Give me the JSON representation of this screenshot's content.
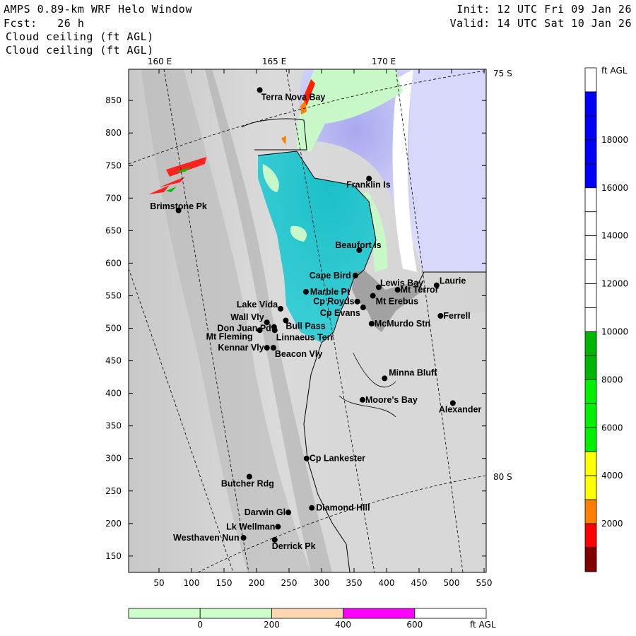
{
  "header": {
    "title": "AMPS 0.89-km WRF Helo Window",
    "forecast": "Fcst:   26 h",
    "init": "Init: 12 UTC Fri 09 Jan 26",
    "valid": "Valid: 14 UTC Sat 10 Jan 26",
    "field1": "Cloud ceiling (ft AGL)",
    "field2": "Cloud ceiling (ft AGL)"
  },
  "map": {
    "lon_labels": [
      "160 E",
      "165 E",
      "170 E"
    ],
    "lat_labels": [
      "75 S",
      "80 S"
    ],
    "x_ticks": [
      50,
      100,
      150,
      200,
      250,
      300,
      350,
      400,
      450,
      500,
      550
    ],
    "y_ticks": [
      150,
      200,
      250,
      300,
      350,
      400,
      450,
      500,
      550,
      600,
      650,
      700,
      750,
      800,
      850
    ],
    "stations": [
      {
        "name": "Terra Nova Bay",
        "x": 205,
        "y": 866
      },
      {
        "name": "Brimstone Pk",
        "x": 80,
        "y": 681
      },
      {
        "name": "Franklin Is",
        "x": 373,
        "y": 730
      },
      {
        "name": "Beaufort Is",
        "x": 358,
        "y": 620
      },
      {
        "name": "Cape Bird",
        "x": 352,
        "y": 581
      },
      {
        "name": "Lewis Bay",
        "x": 388,
        "y": 563
      },
      {
        "name": "Laurie",
        "x": 477,
        "y": 566
      },
      {
        "name": "Mt Terror",
        "x": 417,
        "y": 559
      },
      {
        "name": "Marble Pt",
        "x": 276,
        "y": 556
      },
      {
        "name": "Mt Erebus",
        "x": 379,
        "y": 550
      },
      {
        "name": "Cp Royds",
        "x": 355,
        "y": 541
      },
      {
        "name": "Cp Evans",
        "x": 364,
        "y": 532
      },
      {
        "name": "Lake Vida",
        "x": 237,
        "y": 530
      },
      {
        "name": "Ferrell",
        "x": 483,
        "y": 519
      },
      {
        "name": "Wall Vly",
        "x": 216,
        "y": 509
      },
      {
        "name": "Bull Pass",
        "x": 245,
        "y": 512
      },
      {
        "name": "McMurdo Stn",
        "x": 377,
        "y": 507
      },
      {
        "name": "Don Juan Pd",
        "x": 227,
        "y": 502
      },
      {
        "name": "Mt Fleming",
        "x": 205,
        "y": 497
      },
      {
        "name": "Linnaeus Terr",
        "x": 228,
        "y": 497
      },
      {
        "name": "Kennar Vly",
        "x": 216,
        "y": 470
      },
      {
        "name": "Beacon Vly",
        "x": 226,
        "y": 470
      },
      {
        "name": "Minna Bluff",
        "x": 397,
        "y": 423
      },
      {
        "name": "Moore's Bay",
        "x": 363,
        "y": 390
      },
      {
        "name": "Alexander",
        "x": 502,
        "y": 385
      },
      {
        "name": "Cp Lankester",
        "x": 277,
        "y": 300
      },
      {
        "name": "Butcher Rdg",
        "x": 189,
        "y": 272
      },
      {
        "name": "Diamond Hill",
        "x": 285,
        "y": 224
      },
      {
        "name": "Darwin Gl",
        "x": 249,
        "y": 217
      },
      {
        "name": "Lk Wellman",
        "x": 233,
        "y": 195
      },
      {
        "name": "Westhaven Nun",
        "x": 180,
        "y": 178
      },
      {
        "name": "Derrick Pk",
        "x": 228,
        "y": 175
      }
    ]
  },
  "colorbar": {
    "unit": "ft AGL",
    "labels": [
      "18000",
      "16000",
      "14000",
      "12000",
      "10000",
      "8000",
      "6000",
      "4000",
      "2000"
    ],
    "segments_top_to_bottom": [
      "#ffffff",
      "#0000ff",
      "#0000ff",
      "#0000ff",
      "#0000ff",
      "#ffffff",
      "#ffffff",
      "#ffffff",
      "#ffffff",
      "#ffffff",
      "#ffffff",
      "#00b400",
      "#00b400",
      "#00f000",
      "#00f000",
      "#00f000",
      "#ffff00",
      "#ffff00",
      "#ff8000",
      "#ff0000",
      "#800000"
    ]
  },
  "bottom_bar": {
    "unit": "ft AGL",
    "labels": [
      "0",
      "200",
      "400",
      "600"
    ],
    "segments": [
      "#ccffcc",
      "#ccffcc",
      "#ffd8b0",
      "#ff00ff",
      "#ffffff"
    ]
  },
  "colors": {
    "cyan": "#30c8d0",
    "lavender": "#d8d8fa",
    "lightgreen": "#c8f8c8",
    "land": "#d6d6d6"
  }
}
